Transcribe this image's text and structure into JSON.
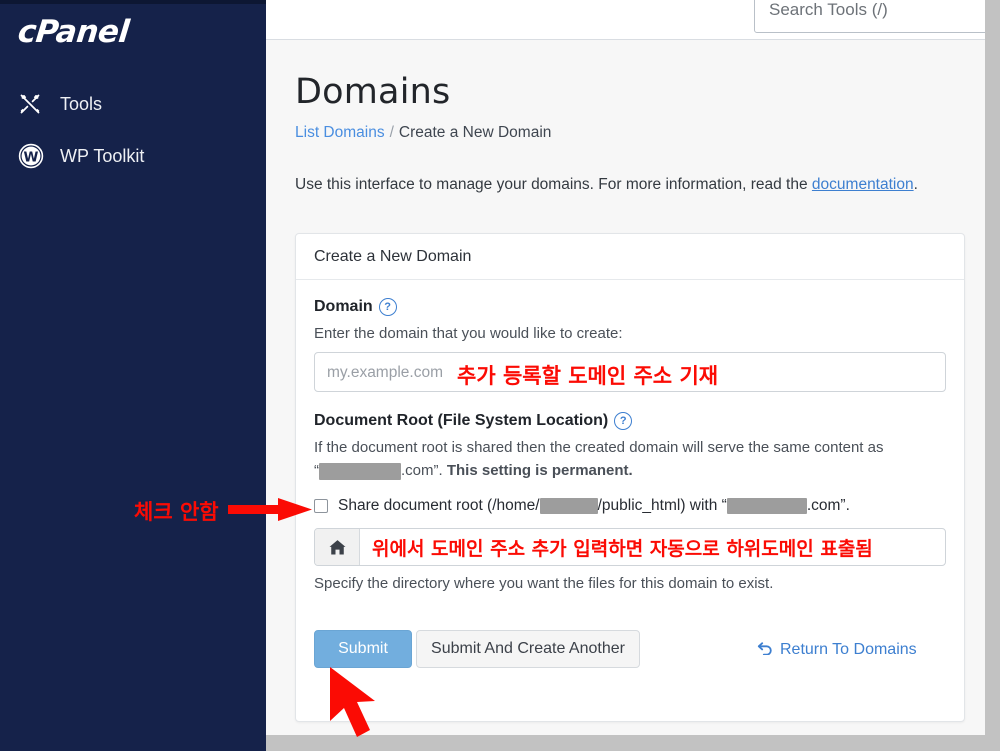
{
  "sidebar": {
    "logo": "cPanel",
    "items": [
      {
        "label": "Tools",
        "icon": "tools-icon"
      },
      {
        "label": "WP Toolkit",
        "icon": "wordpress-icon"
      }
    ]
  },
  "topbar": {
    "search_placeholder": "Search Tools (/)",
    "search_value": ""
  },
  "page": {
    "title": "Domains",
    "breadcrumb": {
      "link": "List Domains",
      "separator": "/",
      "current": "Create a New Domain"
    },
    "intro_before": "Use this interface to manage your domains. For more information, read the ",
    "intro_link": "documentation",
    "intro_after": "."
  },
  "card": {
    "header": "Create a New Domain",
    "domain": {
      "label": "Domain",
      "help_icon": "?",
      "description": "Enter the domain that you would like to create:",
      "placeholder": "my.example.com",
      "value": "",
      "annotation": "추가 등록할 도메인 주소 기재"
    },
    "document_root": {
      "label": "Document Root (File System Location)",
      "help_icon": "?",
      "description_line1": "If the document root is shared then the created domain will serve the same content as",
      "description_line2_quote_open": "“",
      "description_line2_redacted": "[redacted]",
      "description_line2_tld": ".com”.",
      "description_line2_bold": "This setting is permanent.",
      "checkbox": {
        "checked": false,
        "text_part1": "Share document root (/home/",
        "redacted1": "[redacted]",
        "text_part2": "/public_html) with “",
        "redacted2": "[redacted]",
        "text_part3": ".com”."
      },
      "path_input": {
        "addon_icon": "home-icon",
        "value": "",
        "annotation": "위에서 도메인 주소 추가 입력하면 자동으로 하위도메인 표출됨"
      },
      "hint": "Specify the directory where you want the files for this domain to exist."
    },
    "actions": {
      "submit": "Submit",
      "submit_and_create_another": "Submit And Create Another",
      "return_link": "Return To Domains",
      "return_icon": "undo-arrow-icon"
    }
  },
  "annotations": {
    "checkbox_note": "체크 안함",
    "arrow_color": "#fb0b04"
  },
  "colors": {
    "sidebar_bg": "#15224a",
    "accent_blue": "#3d7fd0",
    "primary_button": "#72aede",
    "annotation_red": "#fb0b04",
    "page_bg": "#f7f7f7",
    "chrome_gray": "#c2c2c2"
  }
}
